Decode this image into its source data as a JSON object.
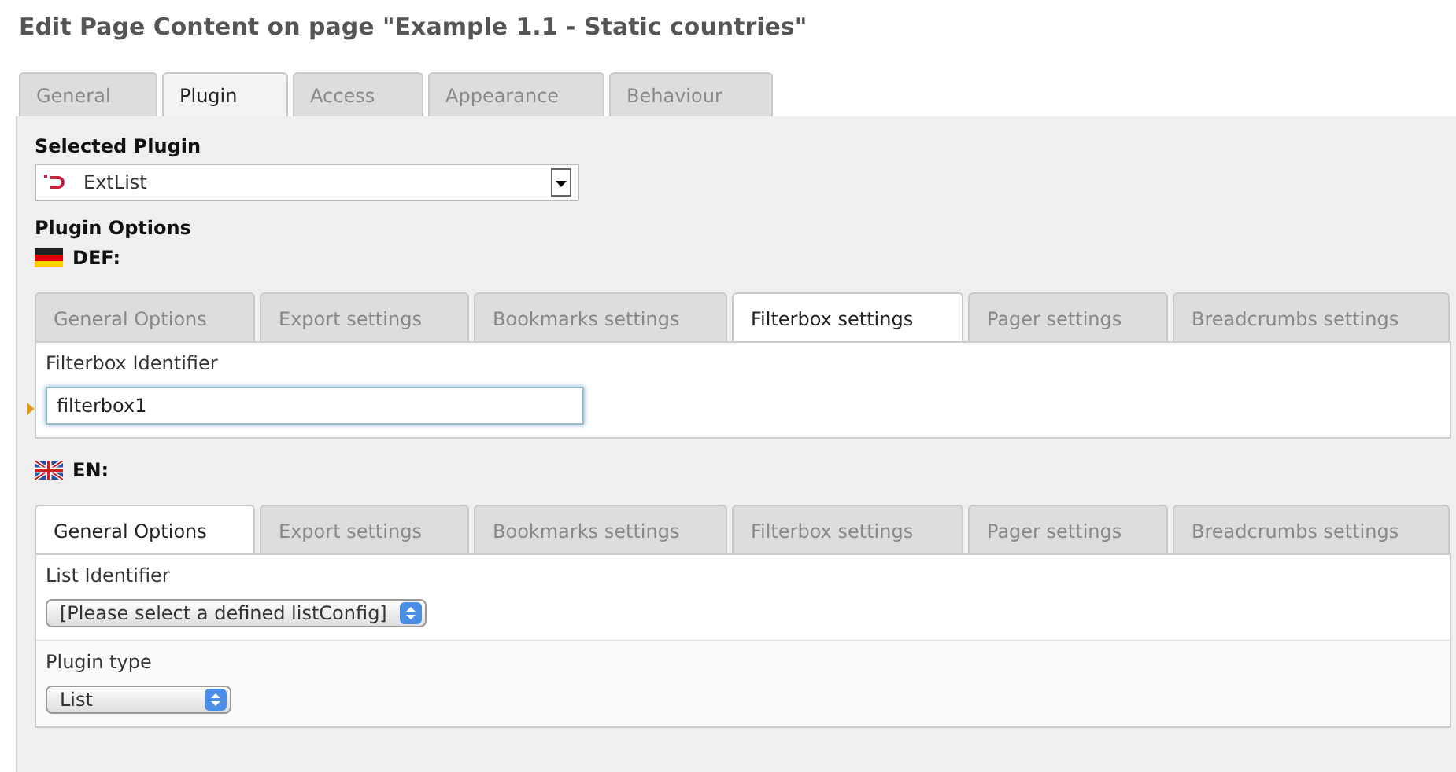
{
  "title": "Edit Page Content on page \"Example 1.1 - Static countries\"",
  "tabs": [
    {
      "label": "General",
      "selected": false
    },
    {
      "label": "Plugin",
      "selected": true
    },
    {
      "label": "Access",
      "selected": false
    },
    {
      "label": "Appearance",
      "selected": false
    },
    {
      "label": "Behaviour",
      "selected": false
    }
  ],
  "selected_plugin": {
    "label": "Selected Plugin",
    "value": "ExtList"
  },
  "plugin_options": {
    "label": "Plugin Options",
    "languages": [
      {
        "kind": "german-flag",
        "label": "DEF:",
        "tabs": [
          {
            "label": "General Options",
            "selected": false
          },
          {
            "label": "Export settings",
            "selected": false
          },
          {
            "label": "Bookmarks settings",
            "selected": false
          },
          {
            "label": "Filterbox settings",
            "selected": true
          },
          {
            "label": "Pager settings",
            "selected": false
          },
          {
            "label": "Breadcrumbs settings",
            "selected": false
          }
        ],
        "fields": [
          {
            "kind": "text",
            "label": "Filterbox Identifier",
            "value": "filterbox1",
            "focused": true
          }
        ]
      },
      {
        "kind": "british-flag",
        "label": "EN:",
        "tabs": [
          {
            "label": "General Options",
            "selected": true
          },
          {
            "label": "Export settings",
            "selected": false
          },
          {
            "label": "Bookmarks settings",
            "selected": false
          },
          {
            "label": "Filterbox settings",
            "selected": false
          },
          {
            "label": "Pager settings",
            "selected": false
          },
          {
            "label": "Breadcrumbs settings",
            "selected": false
          }
        ],
        "fields": [
          {
            "kind": "select",
            "label": "List Identifier",
            "value": "[Please select a defined listConfig]"
          },
          {
            "kind": "select",
            "label": "Plugin type",
            "value": "List"
          }
        ]
      }
    ]
  }
}
